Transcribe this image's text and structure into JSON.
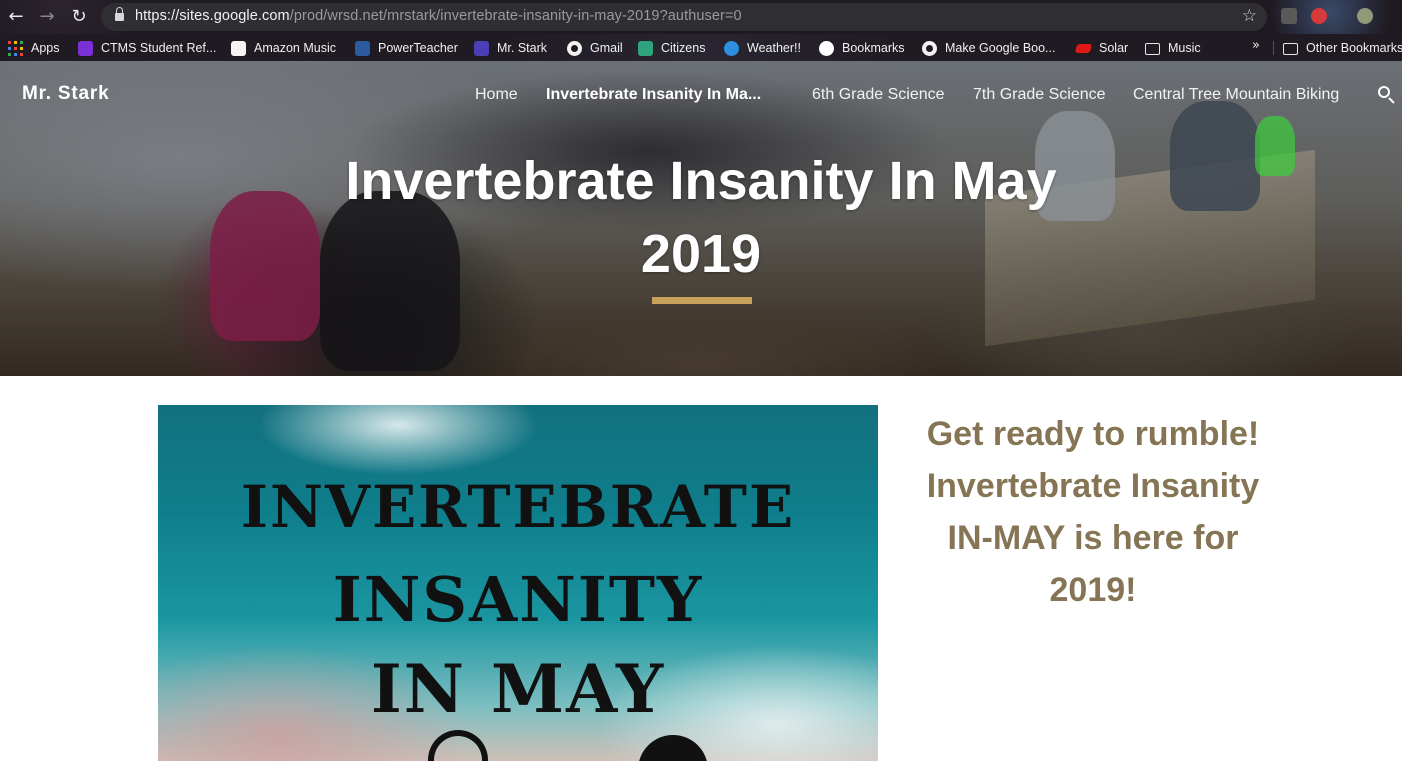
{
  "browser": {
    "url_host": "https://sites.google.com",
    "url_path": "/prod/wrsd.net/mrstark/invertebrate-insanity-in-may-2019?authuser=0",
    "bookmarks": [
      {
        "label": "Apps",
        "icon": "apps-grid-icon"
      },
      {
        "label": "CTMS Student Ref...",
        "icon": "list-icon"
      },
      {
        "label": "Amazon Music",
        "icon": "amazon-icon"
      },
      {
        "label": "PowerTeacher",
        "icon": "powerschool-icon"
      },
      {
        "label": "Mr. Stark",
        "icon": "sites-icon"
      },
      {
        "label": "Gmail",
        "icon": "globe-icon"
      },
      {
        "label": "Citizens",
        "icon": "citizens-icon"
      },
      {
        "label": "Weather!!",
        "icon": "weather-icon"
      },
      {
        "label": "Bookmarks",
        "icon": "google-icon"
      },
      {
        "label": "Make Google Boo...",
        "icon": "globe-icon"
      },
      {
        "label": "Solar",
        "icon": "solar-icon"
      },
      {
        "label": "Music",
        "icon": "folder-icon"
      }
    ],
    "more_chevron": "»",
    "other_bookmarks": "Other Bookmarks"
  },
  "site": {
    "name": "Mr. Stark",
    "nav": [
      {
        "label": "Home",
        "active": false
      },
      {
        "label": "Invertebrate Insanity In Ma...",
        "active": true
      },
      {
        "label": "6th Grade Science",
        "active": false
      },
      {
        "label": "7th Grade Science",
        "active": false
      },
      {
        "label": "Central Tree Mountain Biking",
        "active": false
      }
    ],
    "title_line1": "Invertebrate Insanity In May",
    "title_line2": "2019",
    "accent_color": "#c7a159"
  },
  "content": {
    "poster_lines": [
      "INVERTEBRATE",
      "INSANITY",
      "IN MAY"
    ],
    "blurb": "Get ready to rumble! Invertebrate Insanity IN-MAY is here for 2019!",
    "blurb_color": "#857555"
  }
}
